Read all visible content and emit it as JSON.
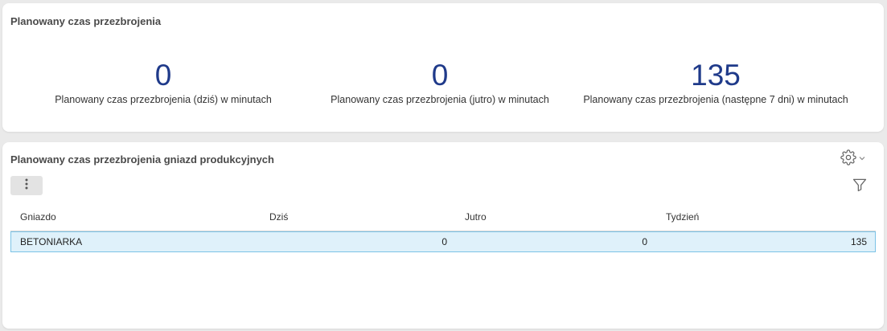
{
  "kpi_card": {
    "title": "Planowany czas przezbrojenia",
    "items": [
      {
        "value": "0",
        "label": "Planowany czas przezbrojenia (dziś) w minutach"
      },
      {
        "value": "0",
        "label": "Planowany czas przezbrojenia (jutro) w minutach"
      },
      {
        "value": "135",
        "label": "Planowany czas przezbrojenia (następne 7 dni) w minutach"
      }
    ]
  },
  "table_card": {
    "title": "Planowany czas przezbrojenia gniazd produkcyjnych",
    "columns": [
      "Gniazdo",
      "Dziś",
      "Jutro",
      "Tydzień"
    ],
    "rows": [
      {
        "gniazdo": "BETONIARKA",
        "dzis": "0",
        "jutro": "0",
        "tydzien": "135"
      }
    ],
    "icons": {
      "settings": "gear-icon",
      "settings_arrow": "chevron-down-icon",
      "filter": "filter-icon",
      "more": "more-vertical-icon"
    }
  },
  "colors": {
    "kpi_value": "#1f3a8a",
    "selected_row_bg": "#dff1fa",
    "selected_row_border": "#7cc3e6"
  }
}
